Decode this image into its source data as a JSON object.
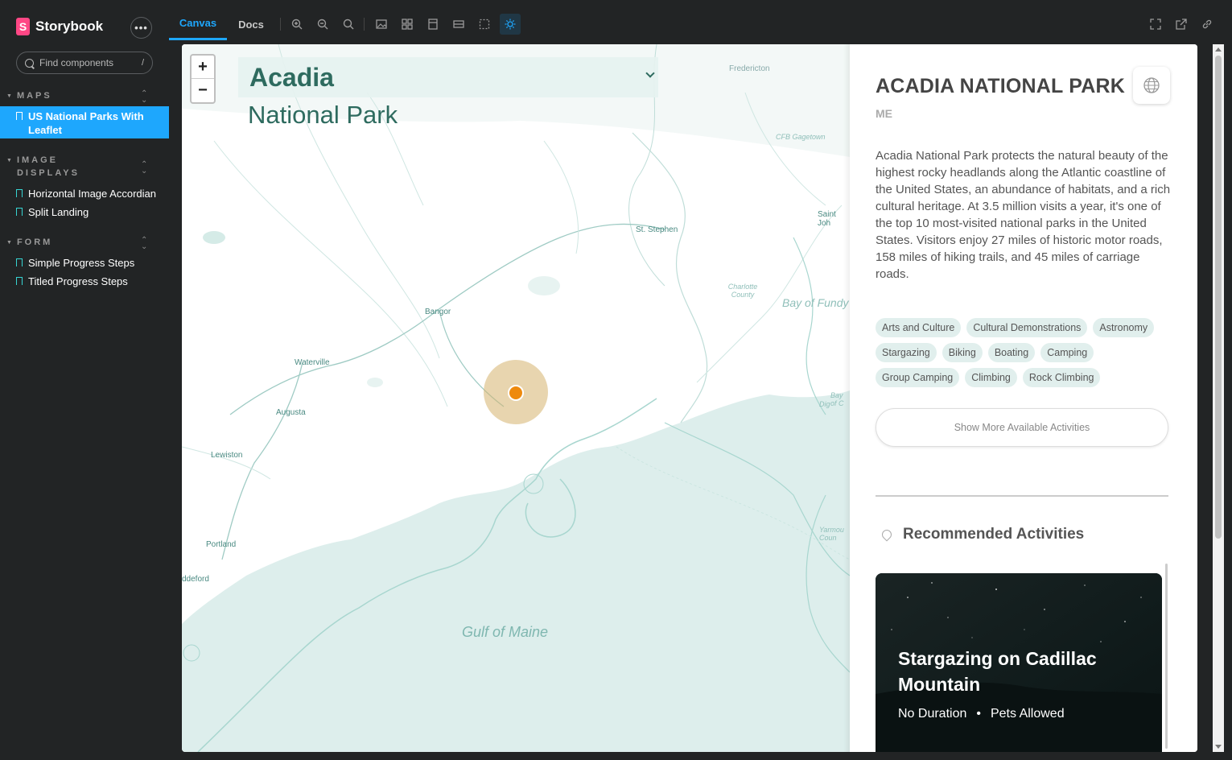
{
  "sidebar": {
    "brand": "Storybook",
    "brand_logo_letter": "S",
    "more_label": "•••",
    "search_placeholder": "Find components",
    "search_shortcut": "/",
    "groups": [
      {
        "label": "MAPS",
        "items": [
          "US National Parks With Leaflet"
        ]
      },
      {
        "label": "IMAGE DISPLAYS",
        "items": [
          "Horizontal Image Accordian",
          "Split Landing"
        ]
      },
      {
        "label": "FORM",
        "items": [
          "Simple Progress Steps",
          "Titled Progress Steps"
        ]
      }
    ]
  },
  "toolbar": {
    "tabs": [
      "Canvas",
      "Docs"
    ],
    "active_tab": "Canvas"
  },
  "map": {
    "zoom_in": "+",
    "zoom_out": "−",
    "selected_park": "Acadia",
    "subtitle": "National Park",
    "labels": {
      "fredericton": "Fredericton",
      "gagetown": "CFB Gagetown",
      "saint_john": "Saint Joh",
      "st_stephen": "St. Stephen",
      "charlotte": "Charlotte County",
      "bay_of_fundy": "Bay of Fundy",
      "bangor": "Bangor",
      "waterville": "Waterville",
      "augusta": "Augusta",
      "lewiston": "Lewiston",
      "portland": "Portland",
      "biddeford": "ddeford",
      "gulf_of_maine": "Gulf of Maine",
      "yarmouth": "Yarmou Coun",
      "digby": "Dig",
      "bay_of": "Bay of C"
    },
    "marker_color": "#ee8a0e"
  },
  "park": {
    "title": "ACADIA NATIONAL PARK",
    "state": "ME",
    "description": "Acadia National Park protects the natural beauty of the highest rocky headlands along the Atlantic coastline of the United States, an abundance of habitats, and a rich cultural heritage. At 3.5 million visits a year, it's one of the top 10 most-visited national parks in the United States. Visitors enjoy 27 miles of historic motor roads, 158 miles of hiking trails, and 45 miles of carriage roads.",
    "activities": [
      "Arts and Culture",
      "Cultural Demonstrations",
      "Astronomy",
      "Stargazing",
      "Biking",
      "Boating",
      "Camping",
      "Group Camping",
      "Climbing",
      "Rock Climbing"
    ],
    "more_activities_label": "Show More Available Activities",
    "recommended_heading": "Recommended Activities",
    "recommended": {
      "title": "Stargazing on Cadillac Mountain",
      "duration": "No Duration",
      "bullet": "•",
      "pets": "Pets Allowed"
    }
  },
  "colors": {
    "accent": "#1ea7fd",
    "brand": "#ff4785",
    "map_water": "#ddeeec",
    "park_green": "#2e6b5f",
    "chip_bg": "#e1efed"
  }
}
